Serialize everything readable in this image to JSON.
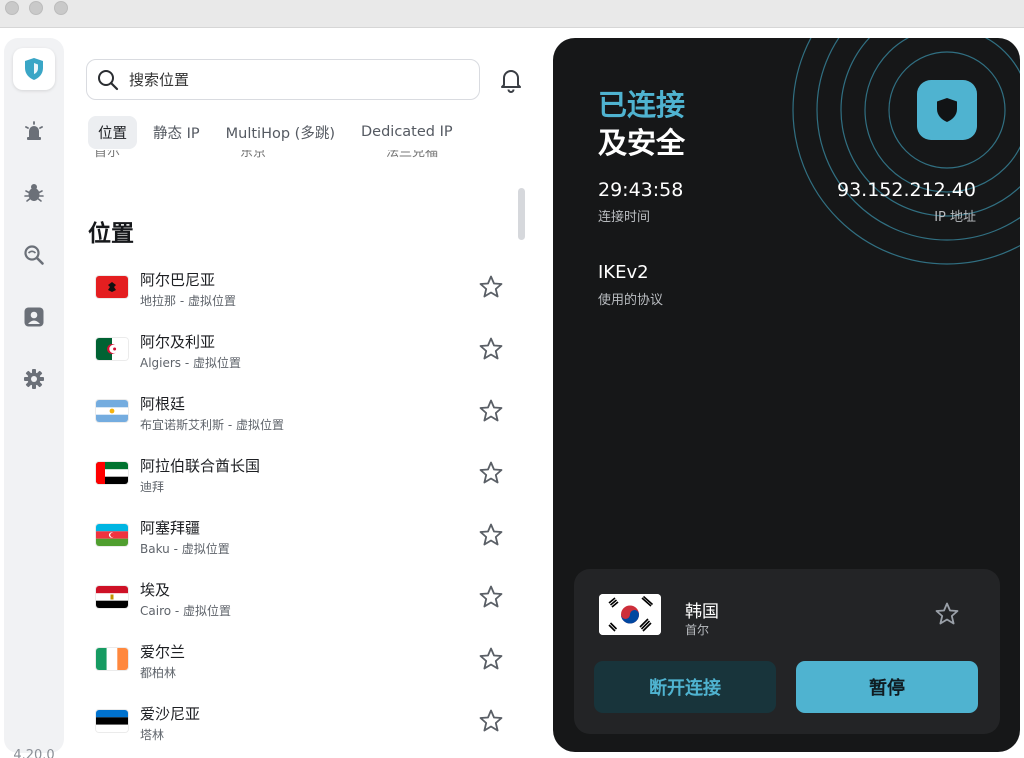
{
  "app": {
    "version": "4.20.0"
  },
  "search": {
    "placeholder": "搜索位置"
  },
  "tabs": [
    {
      "label": "位置",
      "active": true
    },
    {
      "label": "静态 IP",
      "active": false
    },
    {
      "label": "MultiHop (多跳)",
      "active": false
    },
    {
      "label": "Dedicated IP",
      "active": false
    }
  ],
  "cut_row": [
    "首尔",
    "东京",
    "法兰克福"
  ],
  "list": {
    "title": "位置",
    "items": [
      {
        "name": "阿尔巴尼亚",
        "sub": "地拉那 - 虚拟位置",
        "flag": "albania"
      },
      {
        "name": "阿尔及利亚",
        "sub": "Algiers - 虚拟位置",
        "flag": "algeria"
      },
      {
        "name": "阿根廷",
        "sub": "布宜诺斯艾利斯 - 虚拟位置",
        "flag": "argentina"
      },
      {
        "name": "阿拉伯联合酋长国",
        "sub": "迪拜",
        "flag": "uae"
      },
      {
        "name": "阿塞拜疆",
        "sub": "Baku - 虚拟位置",
        "flag": "azerbaijan"
      },
      {
        "name": "埃及",
        "sub": "Cairo - 虚拟位置",
        "flag": "egypt"
      },
      {
        "name": "爱尔兰",
        "sub": "都柏林",
        "flag": "ireland"
      },
      {
        "name": "爱沙尼亚",
        "sub": "塔林",
        "flag": "estonia"
      }
    ]
  },
  "status": {
    "line1": "已连接",
    "line2": "及安全",
    "time_value": "29:43:58",
    "time_label": "连接时间",
    "ip_value": "93.152.212.40",
    "ip_label": "IP 地址",
    "protocol_value": "IKEv2",
    "protocol_label": "使用的协议"
  },
  "location": {
    "country": "韩国",
    "city": "首尔",
    "flag": "south-korea"
  },
  "buttons": {
    "disconnect": "断开连接",
    "pause": "暂停"
  },
  "colors": {
    "accent": "#4fb3d0",
    "panel": "#161718",
    "card": "#232426"
  }
}
